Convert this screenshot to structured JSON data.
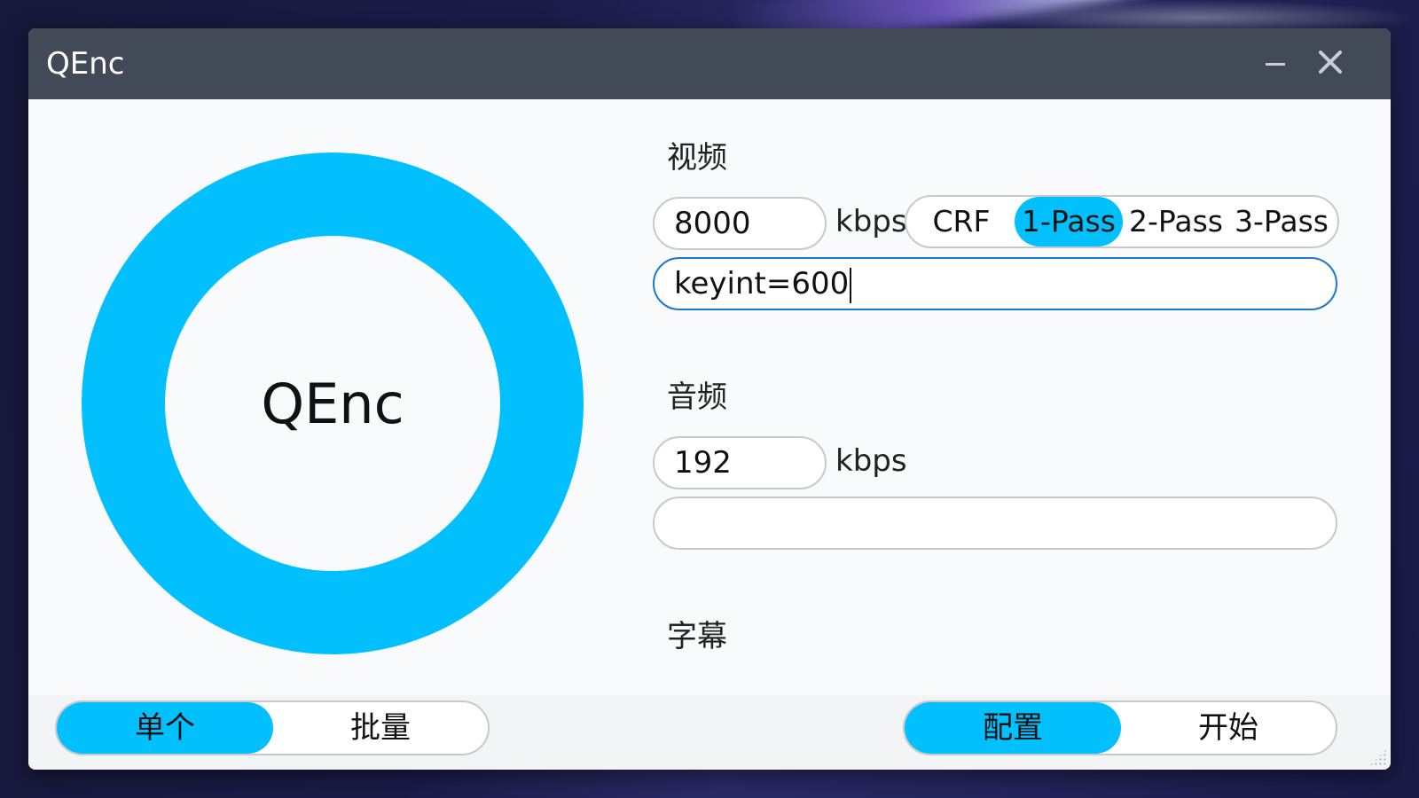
{
  "window": {
    "title": "QEnc",
    "minimize_icon": "minimize-icon",
    "close_icon": "close-icon"
  },
  "progress": {
    "label": "QEnc",
    "color": "#02bffd"
  },
  "video": {
    "section_label": "视频",
    "bitrate_value": "8000",
    "bitrate_unit": "kbps",
    "modes": [
      "CRF",
      "1-Pass",
      "2-Pass",
      "3-Pass"
    ],
    "selected_mode": "1-Pass",
    "params_value": "keyint=600"
  },
  "audio": {
    "section_label": "音频",
    "bitrate_value": "192",
    "bitrate_unit": "kbps",
    "params_value": ""
  },
  "subtitle": {
    "section_label": "字幕"
  },
  "bottom": {
    "mode_tabs": [
      "单个",
      "批量"
    ],
    "selected_mode_tab": "单个",
    "action_tabs": [
      "配置",
      "开始"
    ],
    "selected_action_tab": "配置"
  },
  "colors": {
    "accent": "#02bffd",
    "titlebar": "#434a57",
    "focus_border": "#1a78d0"
  }
}
